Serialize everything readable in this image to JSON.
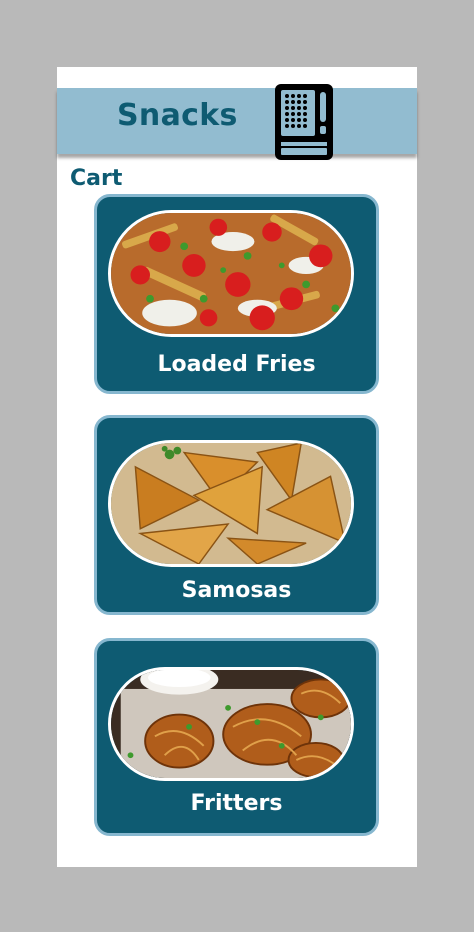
{
  "header": {
    "title": "Snacks",
    "icon": "vending-machine-icon"
  },
  "cart": {
    "label": "Cart"
  },
  "items": [
    {
      "label": "Loaded Fries",
      "image": "loaded-fries-photo"
    },
    {
      "label": "Samosas",
      "image": "samosas-photo"
    },
    {
      "label": "Fritters",
      "image": "fritters-photo"
    }
  ],
  "colors": {
    "background": "#b9b9b9",
    "header": "#92bcd0",
    "accent": "#0e5b72",
    "card_border": "#86b7cf"
  }
}
